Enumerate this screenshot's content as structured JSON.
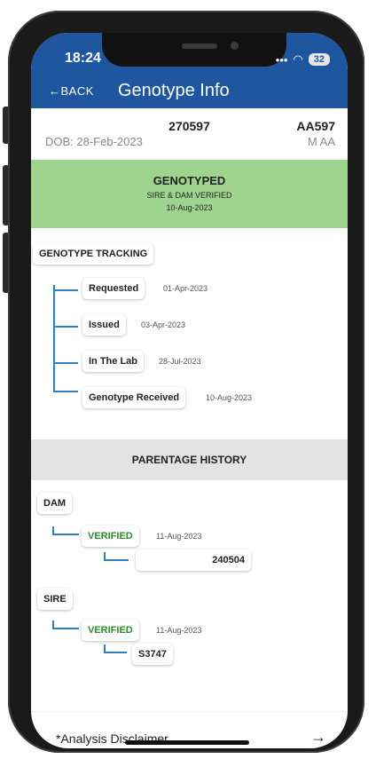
{
  "status_bar": {
    "time": "18:24",
    "battery": "32"
  },
  "header": {
    "back_label": "BACK",
    "title": "Genotype Info"
  },
  "animal": {
    "id": "270597",
    "dob": "DOB: 28-Feb-2023",
    "tag": "AA597",
    "sex_breed": "M AA"
  },
  "genotype_status": {
    "status": "GENOTYPED",
    "subtitle": "SIRE & DAM VERIFIED",
    "date": "10-Aug-2023",
    "color": "#9fd48f"
  },
  "tracking": {
    "heading": "GENOTYPE TRACKING",
    "steps": [
      {
        "label": "Requested",
        "date": "01-Apr-2023"
      },
      {
        "label": "Issued",
        "date": "03-Apr-2023"
      },
      {
        "label": "In The Lab",
        "date": "28-Jul-2023"
      },
      {
        "label": "Genotype Received",
        "date": "10-Aug-2023"
      }
    ]
  },
  "parentage": {
    "heading": "PARENTAGE HISTORY",
    "dam": {
      "label": "DAM",
      "status": "VERIFIED",
      "date": "11-Aug-2023",
      "parent_id": "240504"
    },
    "sire": {
      "label": "SIRE",
      "status": "VERIFIED",
      "date": "11-Aug-2023",
      "parent_id": "S3747"
    }
  },
  "footer": {
    "disclaimer": "*Analysis Disclaimer",
    "arrow_icon": "arrow-right-icon"
  },
  "colors": {
    "appbar": "#1e56a0",
    "tree": "#2e7fbf",
    "verified": "#2e8b2e"
  }
}
